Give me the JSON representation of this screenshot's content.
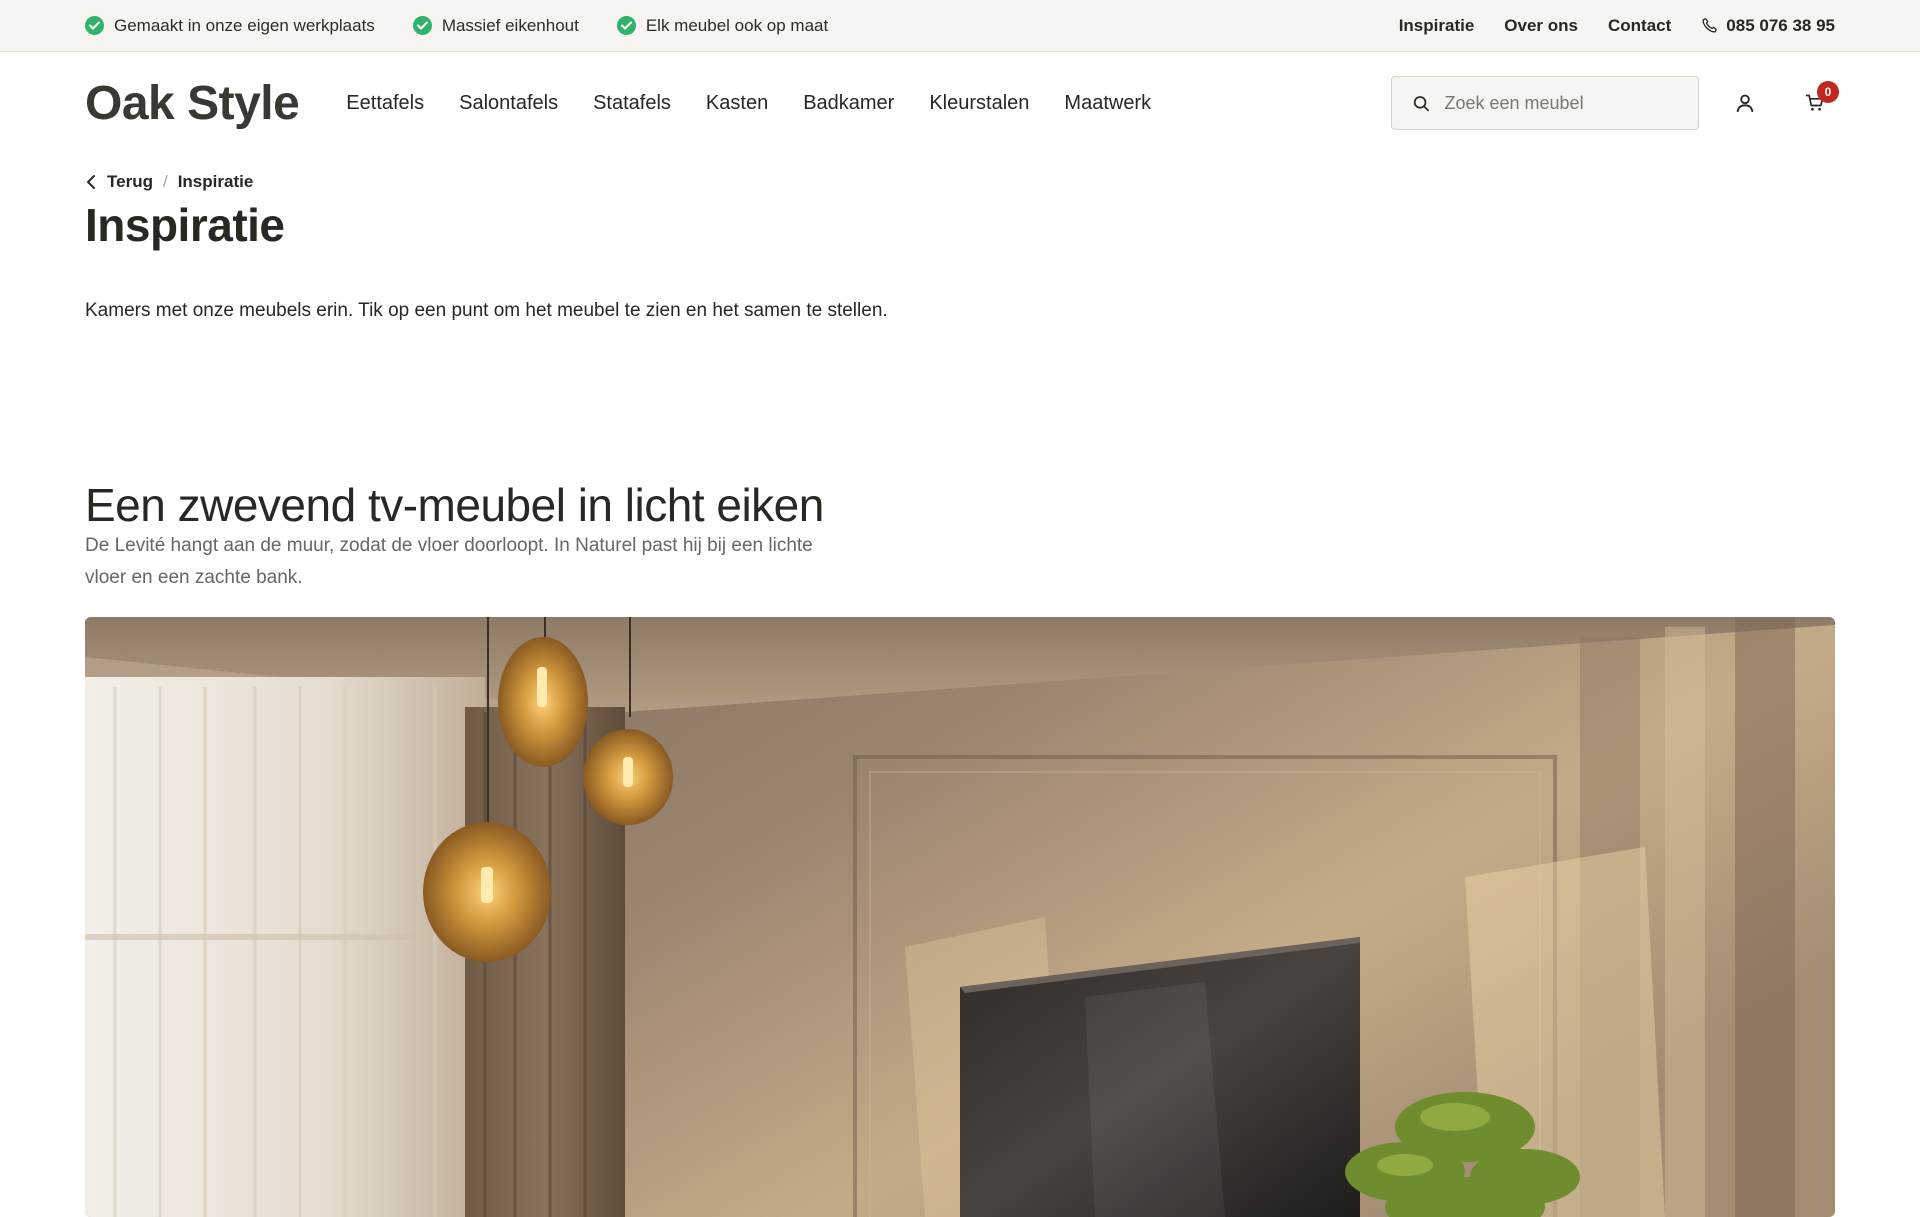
{
  "topbar": {
    "usps": [
      {
        "label": "Gemaakt in onze eigen werkplaats",
        "icon": "check-circle-icon"
      },
      {
        "label": "Massief eikenhout",
        "icon": "check-circle-icon"
      },
      {
        "label": "Elk meubel ook op maat",
        "icon": "check-circle-icon"
      }
    ],
    "links": [
      "Inspiratie",
      "Over ons",
      "Contact"
    ],
    "phone": "085 076 38 95"
  },
  "header": {
    "logo": "Oak Style",
    "nav": [
      "Eettafels",
      "Salontafels",
      "Statafels",
      "Kasten",
      "Badkamer",
      "Kleurstalen",
      "Maatwerk"
    ],
    "search_placeholder": "Zoek een meubel",
    "cart_count": "0"
  },
  "breadcrumb": {
    "back": "Terug",
    "separator": "/",
    "current": "Inspiratie"
  },
  "page": {
    "title": "Inspiratie",
    "intro": "Kamers met onze meubels erin. Tik op een punt om het meubel te zien en het samen te stellen."
  },
  "section": {
    "title": "Een zwevend tv-meubel in licht eiken",
    "description": "De Levité hangt aan de muur, zodat de vloer doorloopt. In Naturel past hij bij een lichte vloer en een zachte bank."
  },
  "colors": {
    "accent_green": "#2fb36a",
    "badge_red": "#c0281f",
    "topbar_bg": "#f7f5f1"
  }
}
